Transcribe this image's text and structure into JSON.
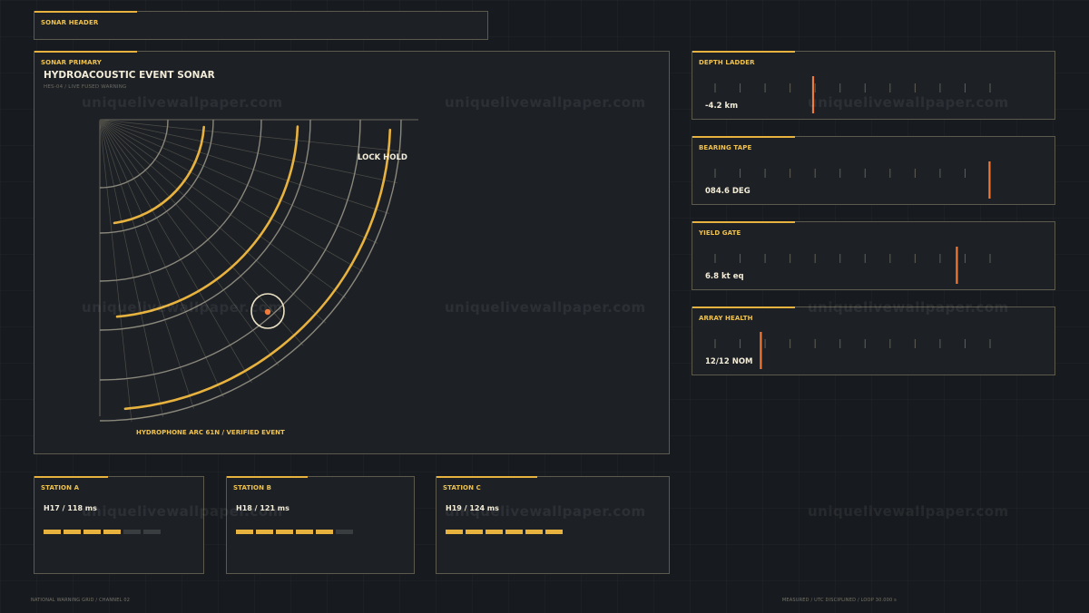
{
  "header": {
    "title": "SONAR HEADER"
  },
  "primary": {
    "label": "SONAR PRIMARY",
    "title": "HYDROACOUSTIC EVENT SONAR",
    "subtitle": "HES-04 / LIVE FUSED WARNING",
    "lock_label": "LOCK HOLD",
    "arc_caption": "HYDROPHONE ARC 61N / VERIFIED EVENT"
  },
  "readouts": [
    {
      "label": "DEPTH LADDER",
      "value": "-4.2 km",
      "marker_fraction": 0.3
    },
    {
      "label": "BEARING TAPE",
      "value": "084.6 DEG",
      "marker_fraction": 0.84
    },
    {
      "label": "YIELD GATE",
      "value": "6.8 kt eq",
      "marker_fraction": 0.74
    },
    {
      "label": "ARRAY HEALTH",
      "value": "12/12 NOM",
      "marker_fraction": 0.14
    }
  ],
  "stations": [
    {
      "label": "STATION A",
      "value": "H17 / 118 ms",
      "active_bars": 4,
      "total_bars": 6
    },
    {
      "label": "STATION B",
      "value": "H18 / 121 ms",
      "active_bars": 5,
      "total_bars": 6
    },
    {
      "label": "STATION C",
      "value": "H19 / 124 ms",
      "active_bars": 6,
      "total_bars": 6
    }
  ],
  "footer": {
    "left": "NATIONAL WARNING GRID / CHANNEL 02",
    "right": "MEASURED / UTC DISCIPLINED / LOOP 30.000 s"
  },
  "watermark": "uniquelivewallpaper.com",
  "colors": {
    "accent": "#e8b23f",
    "marker": "#f07a3a",
    "text": "#f3ecd8",
    "panel": "#1d2126"
  }
}
